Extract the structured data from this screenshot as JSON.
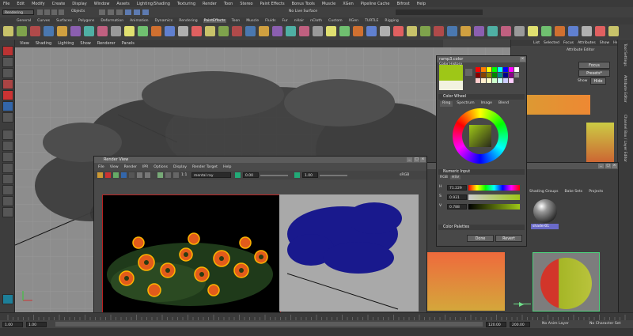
{
  "main_menu": [
    "File",
    "Edit",
    "Modify",
    "Create",
    "Display",
    "Window",
    "Assets",
    "Lighting/Shading",
    "Texturing",
    "Render",
    "Toon",
    "Stereo",
    "Paint Effects",
    "Bonus Tools",
    "Muscle",
    "XGen",
    "Pipeline Cache",
    "Bifrost",
    "Help"
  ],
  "status_line": {
    "menu_set": "Rendering",
    "objects_label": "Objects",
    "no_live_surface": "No Live Surface"
  },
  "shelf_tabs": [
    "General",
    "Curves",
    "Surfaces",
    "Polygons",
    "Deformation",
    "Animation",
    "Dynamics",
    "Rendering",
    "PaintEffects",
    "Toon",
    "Muscle",
    "Fluids",
    "Fur",
    "nHair",
    "nCloth",
    "Custom",
    "XGen",
    "TURTLE",
    "Rigging"
  ],
  "active_shelf_tab": "PaintEffects",
  "viewport_menu": [
    "View",
    "Shading",
    "Lighting",
    "Show",
    "Renderer",
    "Panels"
  ],
  "attribute_editor": {
    "header_menu": [
      "List",
      "Selected",
      "Focus",
      "Attributes",
      "Show",
      "Help"
    ],
    "title": "Attribute Editor",
    "focus_label": "Focus",
    "presets_label": "Presets*",
    "show_label": "Show",
    "hide_label": "Hide"
  },
  "right_tabs": [
    "Tool Settings",
    "Attribute Editor",
    "Channel Box / Layer Editor"
  ],
  "render_view": {
    "title": "Render View",
    "menu": [
      "File",
      "View",
      "Render",
      "IPR",
      "Options",
      "Display",
      "Render Target",
      "Help"
    ],
    "renderer": "mental ray",
    "exposure": "0.00",
    "gamma": "1.00",
    "ratio": "1:1",
    "format": "sRGB"
  },
  "color_chooser": {
    "title": "ramp3.color",
    "history_label": "Color History",
    "wheel_label": "Color Wheel",
    "tabs": [
      "Ring",
      "Spectrum",
      "Image",
      "Blend"
    ],
    "numeric_label": "Numeric Input",
    "mode_tabs": [
      "RGB",
      "HSV"
    ],
    "values": [
      "71.229",
      "0.931",
      "0.788"
    ],
    "hsv_letters": [
      "H",
      "S",
      "V"
    ],
    "palettes_label": "Color Palettes",
    "done_label": "Done",
    "revert_label": "Revert",
    "color": "#9ec717"
  },
  "hypershade": {
    "tabs": [
      "Shading Groups",
      "Bake Sets",
      "Projects"
    ],
    "shader_name": "shader01"
  },
  "range_bar": {
    "start": "1.00",
    "current": "1.00",
    "range_end": "120.00",
    "end": "200.00",
    "anim_layer": "No Anim Layer",
    "character_set": "No Character Set"
  },
  "colors": {
    "accent": "#ffb400",
    "maya_blue": "#00008b"
  }
}
